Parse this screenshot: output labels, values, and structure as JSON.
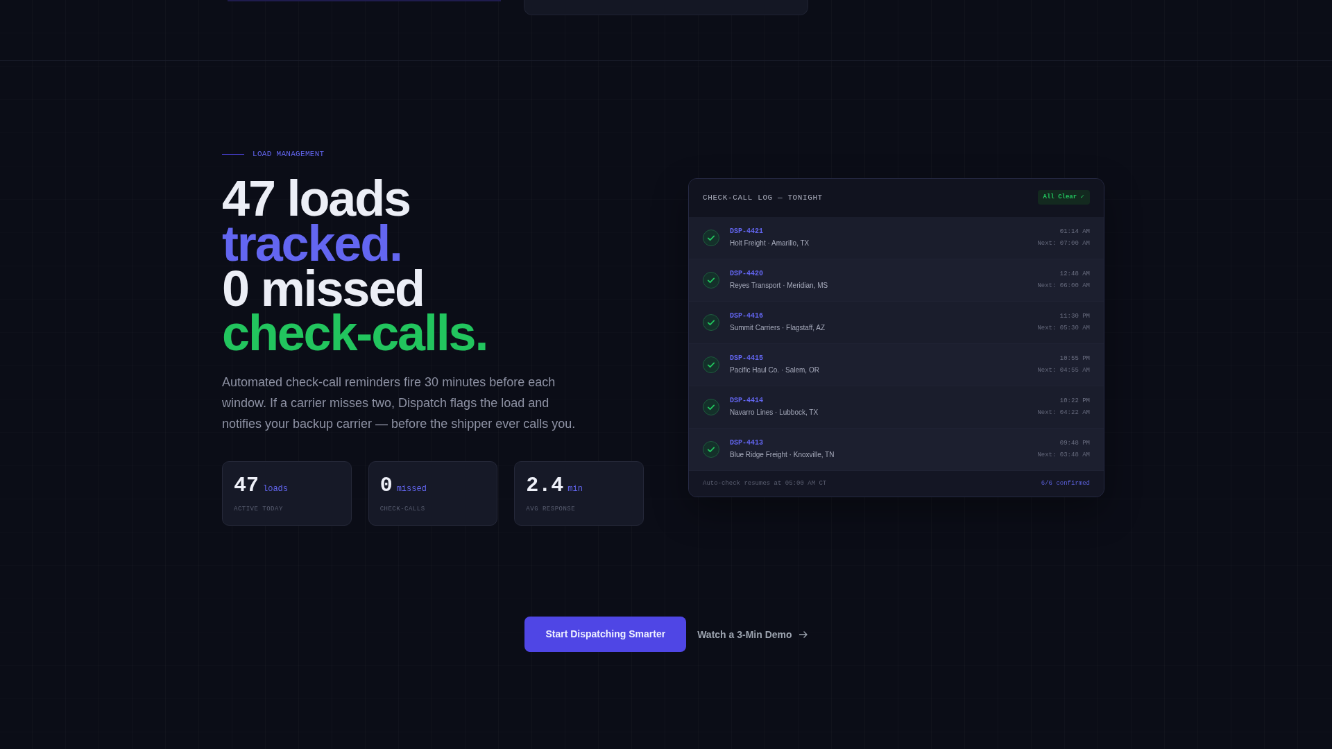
{
  "eyebrow": "LOAD MANAGEMENT",
  "headline": [
    {
      "text": "47 loads",
      "color": "#eceef6"
    },
    {
      "text": "tracked.",
      "color": "#6366f1"
    },
    {
      "text": "0 missed",
      "color": "#eceef6"
    },
    {
      "text": "check-calls.",
      "color": "#22c55e"
    }
  ],
  "description": "Automated check-call reminders fire 30 minutes before each window. If a carrier misses two, Dispatch flags the load and notifies your backup carrier — before the shipper ever calls you.",
  "stats": [
    {
      "value": "47",
      "unit": "loads",
      "label": "ACTIVE TODAY"
    },
    {
      "value": "0",
      "unit": "missed",
      "label": "CHECK-CALLS"
    },
    {
      "value": "2.4",
      "unit": "min",
      "label": "AVG RESPONSE"
    }
  ],
  "log_panel": {
    "title": "CHECK-CALL LOG — TONIGHT",
    "badge": "All Clear ✓",
    "rows": [
      {
        "load_id": "DSP-4421",
        "carrier": "Holt Freight · Amarillo, TX",
        "time": "01:14 AM",
        "next": "Next: 07:00 AM",
        "confirmed": true
      },
      {
        "load_id": "DSP-4420",
        "carrier": "Reyes Transport · Meridian, MS",
        "time": "12:48 AM",
        "next": "Next: 06:00 AM",
        "confirmed": true
      },
      {
        "load_id": "DSP-4416",
        "carrier": "Summit Carriers · Flagstaff, AZ",
        "time": "11:30 PM",
        "next": "Next: 05:30 AM",
        "confirmed": true
      },
      {
        "load_id": "DSP-4415",
        "carrier": "Pacific Haul Co. · Salem, OR",
        "time": "10:55 PM",
        "next": "Next: 04:55 AM",
        "confirmed": true
      },
      {
        "load_id": "DSP-4414",
        "carrier": "Navarro Lines · Lubbock, TX",
        "time": "10:22 PM",
        "next": "Next: 04:22 AM",
        "confirmed": true
      },
      {
        "load_id": "DSP-4413",
        "carrier": "Blue Ridge Freight · Knoxville, TN",
        "time": "09:48 PM",
        "next": "Next: 03:48 AM",
        "confirmed": true
      }
    ],
    "footer_note": "Auto-check resumes at 05:00 AM CT",
    "footer_count": "6/6 confirmed"
  },
  "actions": [
    {
      "label": "Start Dispatching Smarter",
      "kind": "primary"
    },
    {
      "label": "Watch a 3-Min Demo",
      "kind": "link"
    }
  ]
}
